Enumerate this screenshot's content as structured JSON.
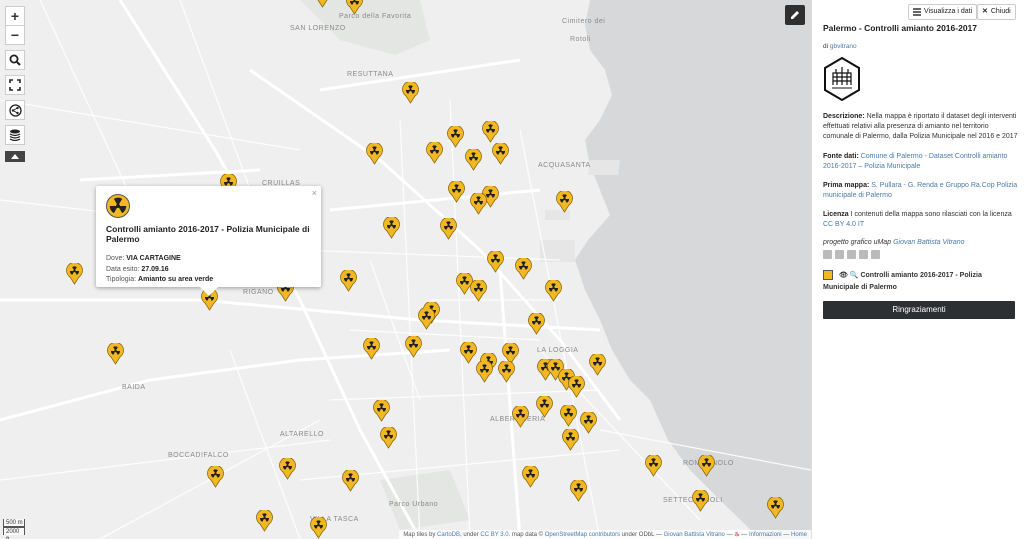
{
  "map": {
    "place_labels": [
      "Parco della Favorita",
      "SAN LORENZO",
      "Cimitero dei",
      "Rotoli",
      "RESUTTANA",
      "CRUILLAS",
      "ACQUASANTA",
      "RIGANO",
      "BAIDA",
      "LA LOGGIA",
      "ALBERGHERIA",
      "ALTARELLO",
      "BOCCADIFALCO",
      "Parco Urbano",
      "VILLA TASCA",
      "ROMAGNOLO",
      "SETTECANNOLI"
    ],
    "controls": {
      "zoom_in": "+",
      "zoom_out": "−",
      "search": "search-icon",
      "fullscreen": "fullscreen-icon",
      "share": "share-icon",
      "layers": "layers-icon",
      "toggle": "caret-up-icon"
    },
    "scale": {
      "metric": "500 m",
      "imperial": "2000 ft"
    },
    "attribution": {
      "prefix": "Map tiles by",
      "carto": "CartoDB",
      "under1": ", under",
      "ccby": "CC BY 3.0",
      "mapdata": ". map data ©",
      "osm": "OpenStreetMap contributors",
      "under2": "under ODbL —",
      "author": "Giovan Battista Vitrano",
      "sep": "—",
      "info": "Informazioni",
      "home": "Home"
    },
    "marker_color": "#f2b823"
  },
  "popup": {
    "close": "×",
    "title": "Controlli amianto 2016-2017 - Polizia Municipale di Palermo",
    "dove_label": "Dove:",
    "dove_value": "VIA CARTAGINE",
    "data_label": "Data esito:",
    "data_value": "27.09.16",
    "tipo_label": "Tipologia:",
    "tipo_value": "Amianto su area verde"
  },
  "panel": {
    "btn_data": "Visualizza i dati",
    "btn_close": "Chiudi",
    "title": "Palermo - Controlli amianto 2016-2017",
    "by_prefix": "di",
    "by_user": "gbvitrano",
    "desc_label": "Descrizione:",
    "desc_text": "Nella mappa è riportato il dataset degli interventi effettuati relativi alla presenza di amianto nel territorio comunale di Palermo, dalla Polizia Municipale nel 2016 e 2017",
    "fonte_label": "Fonte dati:",
    "fonte_text": "Comune di Palermo - Dataset Controlli amianto 2016-2017 – Polizia Municipale",
    "prima_label": "Prima mappa:",
    "prima_text": "S. Pullara - G. Renda e Gruppo Ra.Cop Polizia municipale di Palermo",
    "licenza_label": "Licenza",
    "licenza_text": "I contenuti della mappa sono rilasciati con la licenza",
    "licenza_link": "CC BY 4.0 IT",
    "progetto_text": "progetto grafico uMap",
    "progetto_link": "Giovan Battista Vitrano",
    "layer_label": "Controlli amianto 2016-2017 - Polizia Municipale di Palermo",
    "thanks": "Ringraziamenti",
    "accent": "#4a7aa9"
  }
}
